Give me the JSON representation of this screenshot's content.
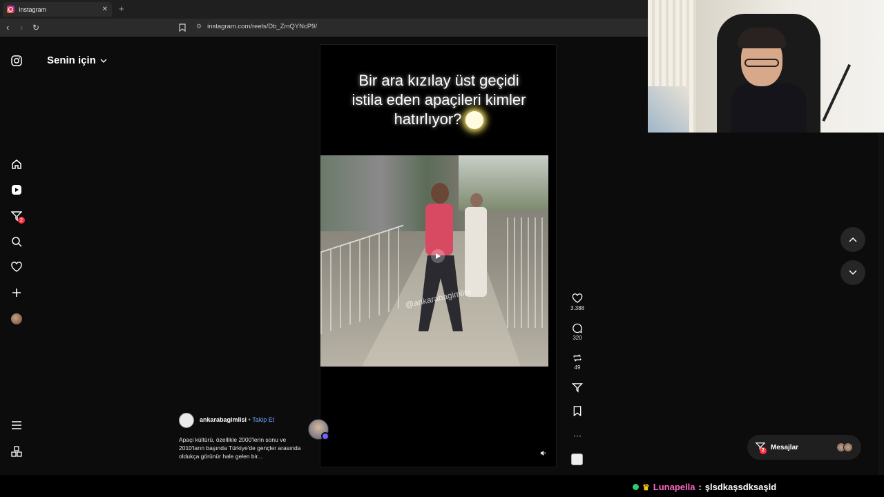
{
  "browser": {
    "tab_title": "Instagram",
    "url": "instagram.com/reels/Db_ZmQYNcP9/"
  },
  "feed": {
    "title": "Senin için"
  },
  "sidebar": {
    "items": [
      {
        "icon": "instagram-logo-icon"
      },
      {
        "icon": "home-icon"
      },
      {
        "icon": "reels-icon"
      },
      {
        "icon": "direct-icon",
        "badge": "2"
      },
      {
        "icon": "search-icon"
      },
      {
        "icon": "heart-icon"
      },
      {
        "icon": "create-icon"
      },
      {
        "icon": "profile-icon"
      },
      {
        "icon": "more-menu-icon"
      },
      {
        "icon": "apps-icon"
      }
    ]
  },
  "video": {
    "caption_lines": [
      "Bir ara kızılay üst geçidi",
      "istila eden apaçileri kimler",
      "hatırlıyor?"
    ],
    "watermark": "@ankarabagimlisi"
  },
  "actions": {
    "likes": "3.388",
    "comments": "320",
    "reposts": "49"
  },
  "post": {
    "author": "ankarabagimlisi",
    "separator": "•",
    "follow_label": "Takip Et",
    "description": "Apaçi kültürü, özellikle 2000'lerin sonu ve 2010'ların başında Türkiye'de gençler arasında oldukça görünür hale gelen bir..."
  },
  "messages": {
    "label": "Mesajlar",
    "badge": "2"
  },
  "chat": {
    "username": "Lunapella",
    "separator": ":",
    "message": "şlsdkaşsdksaşld"
  },
  "colors": {
    "accent_link": "#6fa7ff",
    "badge_red": "#ff3040",
    "chat_user": "#ff66c4"
  }
}
